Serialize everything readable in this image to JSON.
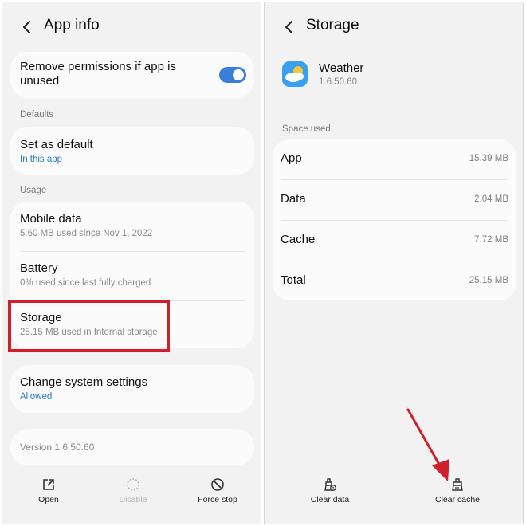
{
  "left": {
    "title": "App info",
    "remove_permissions": "Remove permissions if app is unused",
    "remove_permissions_enabled": true,
    "defaults_label": "Defaults",
    "set_default_title": "Set as default",
    "set_default_sub": "In this app",
    "usage_label": "Usage",
    "mobile_data_title": "Mobile data",
    "mobile_data_sub": "5.60 MB used since Nov 1, 2022",
    "battery_title": "Battery",
    "battery_sub": "0% used since last fully charged",
    "storage_title": "Storage",
    "storage_sub": "25.15 MB used in Internal storage",
    "change_settings_title": "Change system settings",
    "change_settings_sub": "Allowed",
    "version": "Version 1.6.50.60",
    "buttons": {
      "open": "Open",
      "disable": "Disable",
      "force_stop": "Force stop"
    }
  },
  "right": {
    "title": "Storage",
    "app_name": "Weather",
    "app_version": "1.6.50.60",
    "space_used_label": "Space used",
    "rows": [
      {
        "label": "App",
        "value": "15.39 MB"
      },
      {
        "label": "Data",
        "value": "2.04 MB"
      },
      {
        "label": "Cache",
        "value": "7.72 MB"
      },
      {
        "label": "Total",
        "value": "25.15 MB"
      }
    ],
    "buttons": {
      "clear_data": "Clear data",
      "clear_cache": "Clear cache"
    }
  },
  "colors": {
    "accent_blue": "#2a79c8",
    "toggle_blue": "#3a7fd7",
    "highlight_red": "#d01f2b"
  }
}
